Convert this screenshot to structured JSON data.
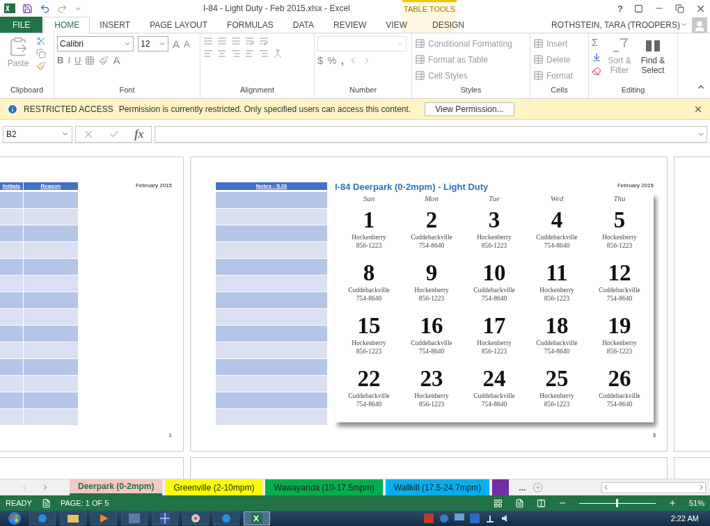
{
  "window": {
    "title": "I-84 - Light Duty - Feb 2015.xlsx - Excel",
    "contextual_header": "TABLE TOOLS",
    "help": "?"
  },
  "tabs": [
    {
      "label": "FILE",
      "kind": "file",
      "selected": false
    },
    {
      "label": "HOME",
      "kind": "normal",
      "selected": true
    },
    {
      "label": "INSERT",
      "kind": "normal",
      "selected": false
    },
    {
      "label": "PAGE LAYOUT",
      "kind": "normal",
      "selected": false
    },
    {
      "label": "FORMULAS",
      "kind": "normal",
      "selected": false
    },
    {
      "label": "DATA",
      "kind": "normal",
      "selected": false
    },
    {
      "label": "REVIEW",
      "kind": "normal",
      "selected": false
    },
    {
      "label": "VIEW",
      "kind": "normal",
      "selected": false
    },
    {
      "label": "DESIGN",
      "kind": "contextual",
      "selected": false
    }
  ],
  "user": "ROTHSTEIN, TARA (TROOPERS)",
  "ribbon": {
    "clipboard": {
      "label": "Clipboard",
      "paste": "Paste"
    },
    "font": {
      "label": "Font",
      "name": "Calibri",
      "size": "12",
      "bold": "B",
      "italic": "I",
      "underline": "U",
      "grow": "A",
      "shrink": "A",
      "font_color_glyph": "A"
    },
    "alignment": {
      "label": "Alignment"
    },
    "number": {
      "label": "Number",
      "currency": "$",
      "percent": "%",
      "comma": ","
    },
    "styles": {
      "label": "Styles",
      "items": [
        {
          "label": "Conditional Formatting",
          "disabled": true
        },
        {
          "label": "Format as Table",
          "disabled": true
        },
        {
          "label": "Cell Styles",
          "disabled": true
        }
      ]
    },
    "cells": {
      "label": "Cells",
      "items": [
        {
          "label": "Insert",
          "disabled": true
        },
        {
          "label": "Delete",
          "disabled": true
        },
        {
          "label": "Format",
          "disabled": true
        }
      ]
    },
    "editing": {
      "label": "Editing",
      "sum": "Σ",
      "items": [
        {
          "label": "Sort & Filter",
          "disabled": true
        },
        {
          "label": "Find & Select",
          "disabled": false
        }
      ]
    }
  },
  "info_bar": {
    "title": "RESTRICTED ACCESS",
    "message": "Permission is currently restricted. Only specified users can access this content.",
    "button": "View Permission..."
  },
  "formula_bar": {
    "name_box": "B2",
    "fx": "fx"
  },
  "pages": {
    "page_1": {
      "columns": [
        "Initials",
        "Reason"
      ],
      "date": "February 2015",
      "number": "1"
    },
    "page_2": {
      "columns": [
        "Notes - SJS"
      ],
      "title": "I-84 Deerpark (0-2mpm) - Light Duty",
      "date": "February 2015",
      "number": "3",
      "calendar": {
        "days": [
          "Sun",
          "Mon",
          "Tue",
          "Wed",
          "Thu"
        ],
        "weeks": [
          [
            {
              "day": "1",
              "name": "Hockenberry",
              "phone": "856-1223"
            },
            {
              "day": "2",
              "name": "Cuddebackville",
              "phone": "754-8640"
            },
            {
              "day": "3",
              "name": "Hockenberry",
              "phone": "856-1223"
            },
            {
              "day": "4",
              "name": "Cuddebackville",
              "phone": "754-8640"
            },
            {
              "day": "5",
              "name": "Hockenberry",
              "phone": "856-1223"
            }
          ],
          [
            {
              "day": "8",
              "name": "Cuddebackville",
              "phone": "754-8640"
            },
            {
              "day": "9",
              "name": "Hockenberry",
              "phone": "856-1223"
            },
            {
              "day": "10",
              "name": "Cuddebackville",
              "phone": "754-8640"
            },
            {
              "day": "11",
              "name": "Hockenberry",
              "phone": "856-1223"
            },
            {
              "day": "12",
              "name": "Cuddebackville",
              "phone": "754-8640"
            }
          ],
          [
            {
              "day": "15",
              "name": "Hockenberry",
              "phone": "856-1223"
            },
            {
              "day": "16",
              "name": "Cuddebackville",
              "phone": "754-8640"
            },
            {
              "day": "17",
              "name": "Hockenberry",
              "phone": "856-1223"
            },
            {
              "day": "18",
              "name": "Cuddebackville",
              "phone": "754-8640"
            },
            {
              "day": "19",
              "name": "Hockenberry",
              "phone": "856-1223"
            }
          ],
          [
            {
              "day": "22",
              "name": "Cuddebackville",
              "phone": "754-8640"
            },
            {
              "day": "23",
              "name": "Hockenberry",
              "phone": "856-1223"
            },
            {
              "day": "24",
              "name": "Cuddebackville",
              "phone": "754-8640"
            },
            {
              "day": "25",
              "name": "Hockenberry",
              "phone": "856-1223"
            },
            {
              "day": "26",
              "name": "Cuddebackville",
              "phone": "754-8640"
            }
          ]
        ]
      }
    }
  },
  "sheet_tabs": [
    {
      "label": "Deerpark (0-2mpm)",
      "color": "#f4c7c3",
      "selected": true
    },
    {
      "label": "Greenville (2-10mpm)",
      "color": "#ffff00",
      "selected": false
    },
    {
      "label": "Wawayanda (10-17.5mpm)",
      "color": "#00b050",
      "selected": false
    },
    {
      "label": "Wallkill (17.5-24.7mpm)",
      "color": "#00b0f0",
      "selected": false
    },
    {
      "color": "#7030a0",
      "selected": false
    }
  ],
  "more_tabs": "...",
  "status_bar": {
    "state": "READY",
    "page": "PAGE: 1 OF 5",
    "zoom": "51%",
    "level": 0.5
  },
  "taskbar": {
    "time": "2:22 AM"
  }
}
